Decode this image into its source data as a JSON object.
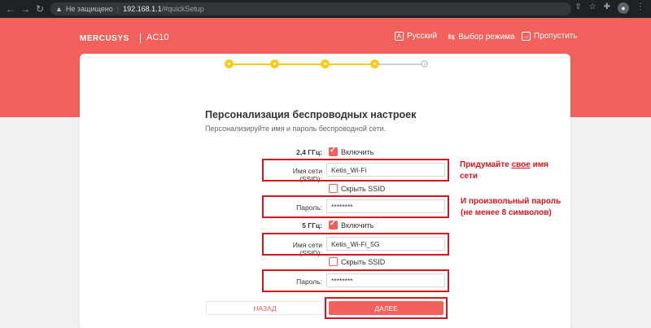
{
  "browser": {
    "security_text": "Не защищено",
    "host": "192.168.1.1",
    "path": "/#quickSetup"
  },
  "header": {
    "logo": "MERCUSYS",
    "model": "AC10",
    "language_label": "Русский",
    "mode_label": "Выбор режима",
    "skip_label": "Пропустить"
  },
  "steps": {
    "total": 5,
    "completed": 4,
    "accent": "#f8cc1b"
  },
  "page": {
    "title": "Персонализация беспроводных настроек",
    "subtitle": "Персонализируйте имя и пароль беспроводной сети."
  },
  "band24": {
    "band_label": "2,4 ГГц:",
    "enable_label": "Включить",
    "enabled": true,
    "ssid_label": "Имя сети (SSID):",
    "ssid_value": "Ketis_Wi-Fi",
    "hide_label": "Скрыть SSID",
    "hidden": false,
    "password_label": "Пароль:",
    "password_value": "********"
  },
  "band5": {
    "band_label": "5 ГГц:",
    "enable_label": "Включить",
    "enabled": true,
    "ssid_label": "Имя сети (SSID):",
    "ssid_value": "Ketis_Wi-Fi_5G",
    "hide_label": "Скрыть SSID",
    "hidden": false,
    "password_label": "Пароль:",
    "password_value": "********"
  },
  "annotations": {
    "ssid_note_pre": "Придумайте ",
    "ssid_note_underlined": "свое",
    "ssid_note_post": " имя сети",
    "password_note": "И произвольный пароль (не менее 8 символов)"
  },
  "buttons": {
    "back": "НАЗАД",
    "next": "ДАЛЕЕ"
  },
  "colors": {
    "brand": "#f4615c",
    "annotation": "#e4141c"
  }
}
